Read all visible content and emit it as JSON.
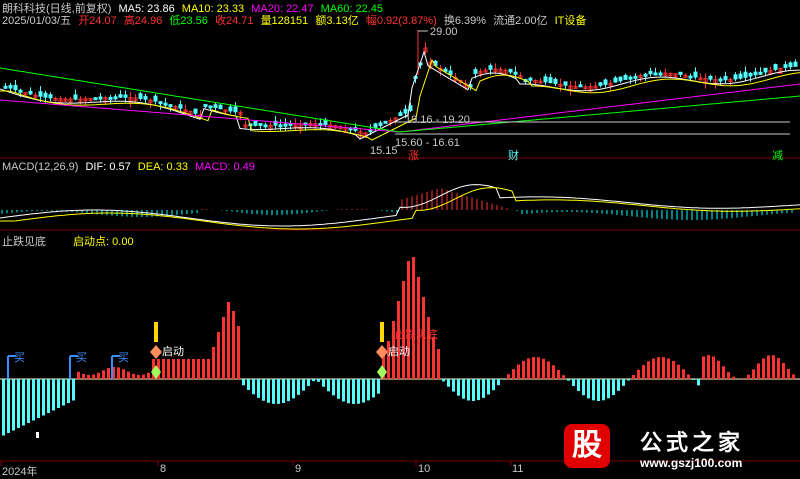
{
  "header": {
    "stock_title": "朗科科技(日线,前复权)",
    "ma5": "MA5: 23.86",
    "ma10": "MA10: 23.33",
    "ma20": "MA20: 22.47",
    "ma60": "MA60: 22.45",
    "date": "2025/01/03/五",
    "open": "开24.07",
    "high": "高24.96",
    "low": "低23.56",
    "close": "收24.71",
    "volume": "量128151",
    "amount": "额3.13亿",
    "change": "幅0.92(3.87%)",
    "turnover": "换6.39%",
    "float": "流通2.00亿",
    "sector": "IT设备"
  },
  "price_annotations": {
    "high_label": "29.00",
    "range1": "19.16 - 19.20",
    "range2": "15.60 - 16.61",
    "low_label": "15.15",
    "mark_zhang": "涨",
    "mark_cai": "财",
    "mark_jian": "减"
  },
  "macd": {
    "title": "MACD(12,26,9)",
    "dif": "DIF: 0.57",
    "dea": "DEA: 0.33",
    "macd": "MACD: 0.49"
  },
  "indicator": {
    "title": "止跌见底",
    "start_point": "启动点: 0.00",
    "buy_label": "买",
    "start_label": "启动",
    "bottom_label": "止跌见底"
  },
  "x_axis": {
    "labels": [
      "2024年",
      "8",
      "9",
      "10",
      "11"
    ]
  },
  "watermark": {
    "mark": "股",
    "name": "公式之家",
    "url": "www.gszj100.com"
  },
  "colors": {
    "up": "#ff3232",
    "down": "#54ffff",
    "ma5": "#ffffff",
    "ma10": "#ffff00",
    "ma20": "#ff00ff",
    "ma60": "#00ff00",
    "dif": "#ffffff",
    "dea": "#ffff00",
    "macd_up": "#ff3232",
    "macd_down": "#00ffff",
    "buy": "#3a8cff",
    "neg_bar": "#a0a0ff"
  }
}
